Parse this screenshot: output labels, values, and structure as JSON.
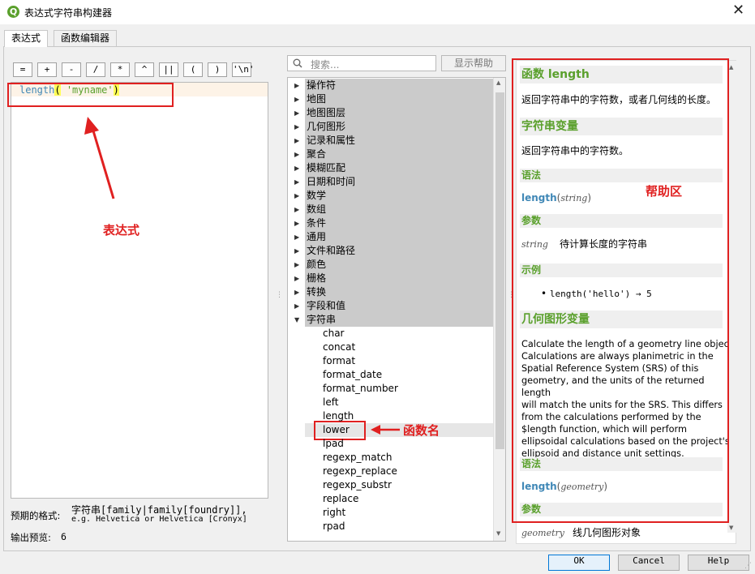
{
  "window": {
    "title": "表达式字符串构建器",
    "logo": "Q",
    "close": "✕"
  },
  "tabs": [
    "表达式",
    "函数编辑器"
  ],
  "operators": [
    "=",
    "+",
    "-",
    "/",
    "*",
    "^",
    "||",
    "(",
    ")",
    "'\\n'"
  ],
  "editor": {
    "fn": "length",
    "p1": "(",
    "str": " 'myname'",
    "p2": ")"
  },
  "expected": {
    "label": "预期的格式:",
    "line1": "字符串[family|family[foundry]],",
    "line2": "e.g. Helvetica or Helvetica [Cronyx]"
  },
  "output": {
    "label": "输出预览:",
    "value": "6"
  },
  "annotations": {
    "expression": "表达式",
    "function_name": "函数名",
    "help_area": "帮助区"
  },
  "search": {
    "placeholder": "搜索...",
    "show_help": "显示帮助"
  },
  "tree": {
    "groups": [
      "操作符",
      "地图",
      "地图图层",
      "几何图形",
      "记录和属性",
      "聚合",
      "模糊匹配",
      "日期和时间",
      "数学",
      "数组",
      "条件",
      "通用",
      "文件和路径",
      "颜色",
      "栅格",
      "转换",
      "字段和值",
      "字符串"
    ],
    "items": [
      "char",
      "concat",
      "format",
      "format_date",
      "format_number",
      "left",
      "length",
      "lower",
      "lpad",
      "regexp_match",
      "regexp_replace",
      "regexp_substr",
      "replace",
      "right",
      "rpad"
    ]
  },
  "help": {
    "h1": "函数 length",
    "d1": "返回字符串中的字符数，或者几何线的长度。",
    "h2": "字符串变量",
    "d2": "返回字符串中的字符数。",
    "s_syntax": "语法",
    "syn_fn": "length",
    "syn_arg": "string",
    "s_args": "参数",
    "arg_name": "string",
    "arg_desc": "待计算长度的字符串",
    "s_example": "示例",
    "example": "length('hello') → 5",
    "h3": "几何图形变量",
    "d3": [
      "Calculate the length of a geometry line object.",
      "Calculations are always planimetric in the",
      "Spatial Reference System (SRS) of this",
      "geometry, and the units of the returned length",
      "will match the units for the SRS. This differs",
      "from the calculations performed by the",
      "$length function, which will perform",
      "ellipsoidal calculations based on the project's",
      "ellipsoid and distance unit settings."
    ],
    "s_syntax2": "语法",
    "syn2_fn": "length",
    "syn2_arg": "geometry",
    "s_args2": "参数",
    "arg2_name": "geometry",
    "arg2_desc": "线几何图形对象"
  },
  "buttons": {
    "ok": "OK",
    "cancel": "Cancel",
    "help": "Help"
  },
  "colors": {
    "accent": "#5aa02c",
    "annotation": "#e02020",
    "function": "#3f87b6"
  }
}
